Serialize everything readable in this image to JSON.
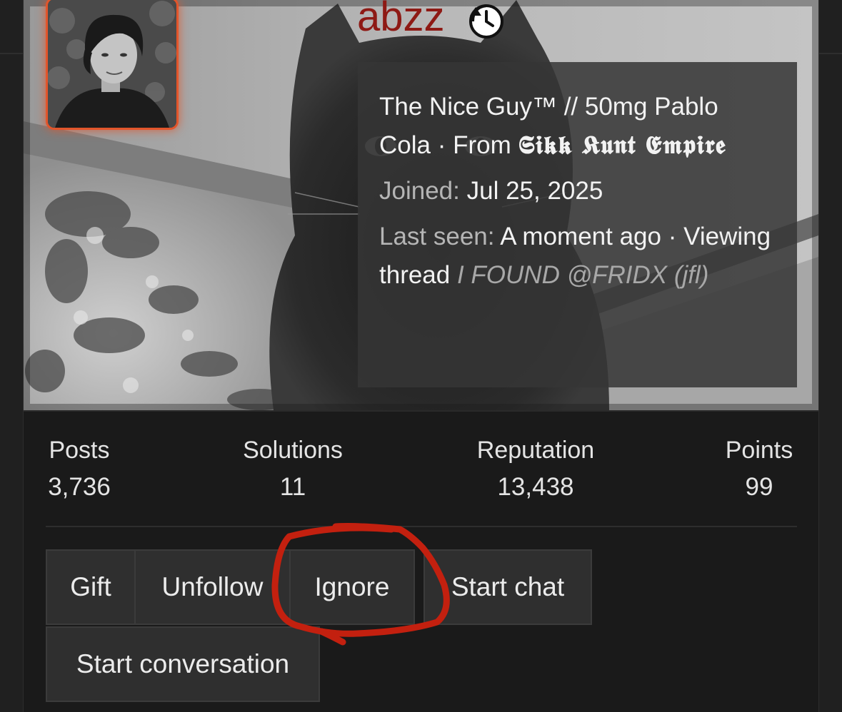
{
  "profile": {
    "username": "abzz",
    "title": "The Nice Guy™ // 50mg Pablo Cola",
    "from_label": "From",
    "from_place": "𝕾𝖎𝖐𝖐 𝕶𝖚𝖓𝖙 𝕰𝖒𝖕𝖎𝖗𝖊",
    "joined_label": "Joined:",
    "joined_value": "Jul 25, 2025",
    "last_seen_label": "Last seen:",
    "last_seen_value": "A moment ago",
    "viewing_label": "Viewing thread",
    "viewing_thread": "I FOUND @FRIDX (jfl)",
    "separator": "·"
  },
  "stats": [
    {
      "label": "Posts",
      "value": "3,736"
    },
    {
      "label": "Solutions",
      "value": "11"
    },
    {
      "label": "Reputation",
      "value": "13,438"
    },
    {
      "label": "Points",
      "value": "99"
    }
  ],
  "actions": {
    "gift": "Gift",
    "unfollow": "Unfollow",
    "ignore": "Ignore",
    "start_chat": "Start chat",
    "start_conversation": "Start conversation"
  },
  "colors": {
    "username": "#8e1a15",
    "avatar_border": "#e2552b",
    "annotation": "#c3200f",
    "background": "#1a1a1a",
    "button": "#2f2f2f"
  },
  "icons": {
    "username_badge": "replay-badge-icon",
    "avatar": "user-avatar-photo"
  }
}
